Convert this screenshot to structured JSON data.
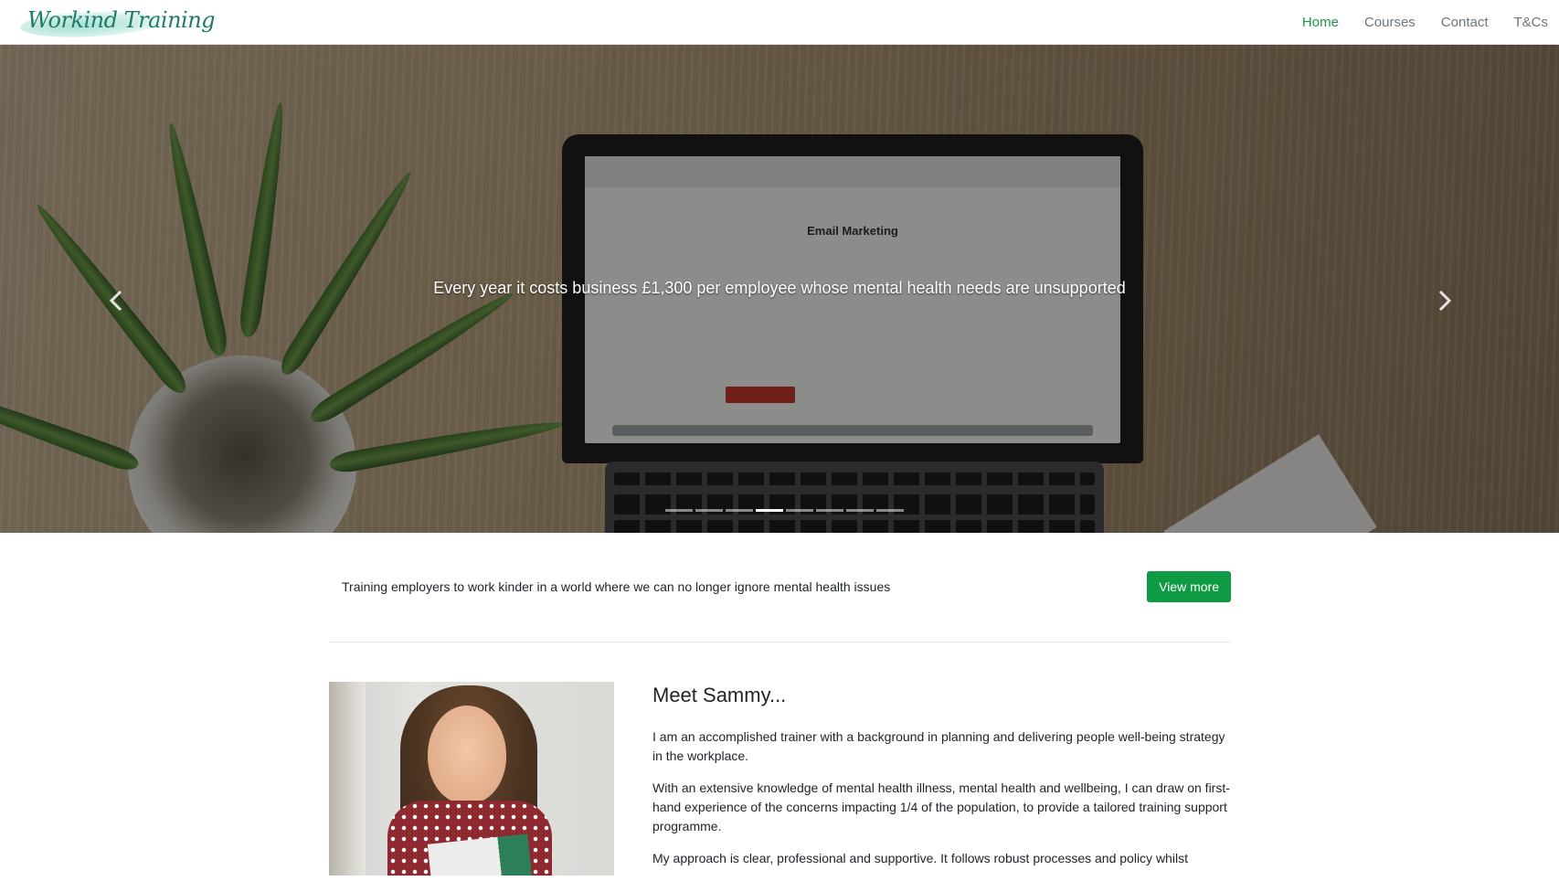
{
  "brand": {
    "logo_text": "Workind Training",
    "accent_color": "#199848",
    "button_color": "#0f9a44"
  },
  "nav": {
    "items": [
      {
        "label": "Home",
        "active": true
      },
      {
        "label": "Courses",
        "active": false
      },
      {
        "label": "Contact",
        "active": false
      },
      {
        "label": "T&Cs",
        "active": false
      }
    ]
  },
  "hero": {
    "caption": "Every year it costs business £1,300 per employee whose mental health needs are unsupported",
    "screen_heading": "Email Marketing",
    "prev_icon": "chevron-left-icon",
    "next_icon": "chevron-right-icon",
    "slide_count": 8,
    "active_slide": 3
  },
  "tagline": {
    "text": "Training employers to work kinder in a world where we can no longer ignore mental health issues",
    "button_label": "View more"
  },
  "about": {
    "heading": "Meet Sammy...",
    "paragraphs": [
      "I am an accomplished trainer with a background in planning and delivering people well-being strategy in the workplace.",
      "With an extensive knowledge of mental health illness, mental health and wellbeing, I can draw on first-hand experience of the concerns impacting 1/4 of the population, to provide a tailored training support programme.",
      "My approach is clear, professional and supportive. It follows robust processes and policy whilst"
    ]
  }
}
